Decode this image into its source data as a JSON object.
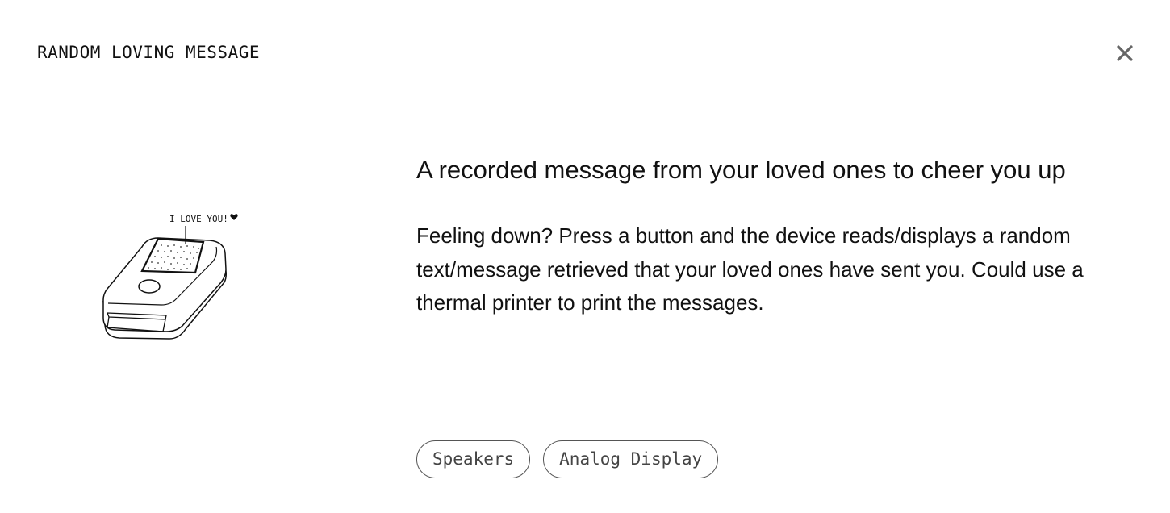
{
  "modal": {
    "title": "RANDOM LOVING MESSAGE",
    "close_icon": "close-icon"
  },
  "illustration": {
    "speech_text": "I LOVE YOU!",
    "heart_icon": "heart-icon"
  },
  "content": {
    "headline": "A recorded message from your loved ones to cheer you up",
    "description": "Feeling down? Press a button and the device reads/displays a random text/message retrieved that your loved ones have sent you. Could use a thermal printer to print the messages."
  },
  "tags": [
    {
      "label": "Speakers"
    },
    {
      "label": "Analog Display"
    }
  ],
  "colors": {
    "text": "#111111",
    "divider": "#cfcfcf",
    "tag_border": "#555555",
    "close_icon": "#666666"
  }
}
